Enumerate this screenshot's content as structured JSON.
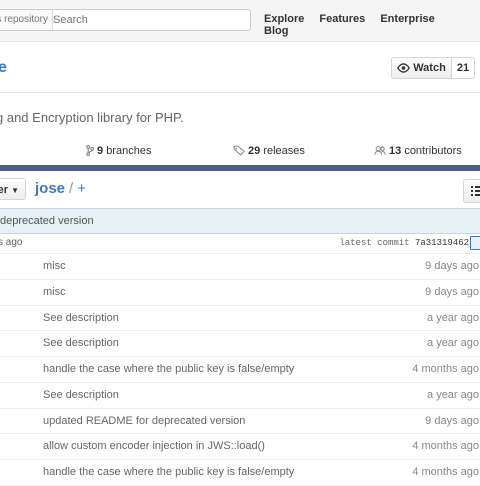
{
  "header": {
    "search_scope": "This repository",
    "search_placeholder": "Search",
    "nav": [
      "Explore",
      "Features",
      "Enterprise",
      "Blog"
    ]
  },
  "repo": {
    "name": "e",
    "watch_label": "Watch",
    "watch_count": "21",
    "description": "g and Encryption library for PHP."
  },
  "stats": {
    "branches_count": "9",
    "branches_label": "branches",
    "releases_count": "29",
    "releases_label": "releases",
    "contributors_count": "13",
    "contributors_label": "contributors"
  },
  "branch": {
    "label": "ter",
    "path_root": "jose",
    "path_sep": "/",
    "path_add": "+"
  },
  "commit": {
    "message": "deprecated version",
    "ago": "s ago",
    "latest_label": "latest commit",
    "sha": "7a31319462"
  },
  "files": [
    {
      "message": "misc",
      "age": "9 days ago"
    },
    {
      "message": "misc",
      "age": "9 days ago"
    },
    {
      "message": "See description",
      "age": "a year ago"
    },
    {
      "message": "See description",
      "age": "a year ago"
    },
    {
      "message": "handle the case where the public key is false/empty",
      "age": "4 months ago"
    },
    {
      "message": "See description",
      "age": "a year ago"
    },
    {
      "message": "updated README for deprecated version",
      "age": "9 days ago"
    },
    {
      "message": "allow custom encoder injection in JWS::load()",
      "age": "4 months ago"
    },
    {
      "message": "handle the case where the public key is false/empty",
      "age": "4 months ago"
    }
  ]
}
